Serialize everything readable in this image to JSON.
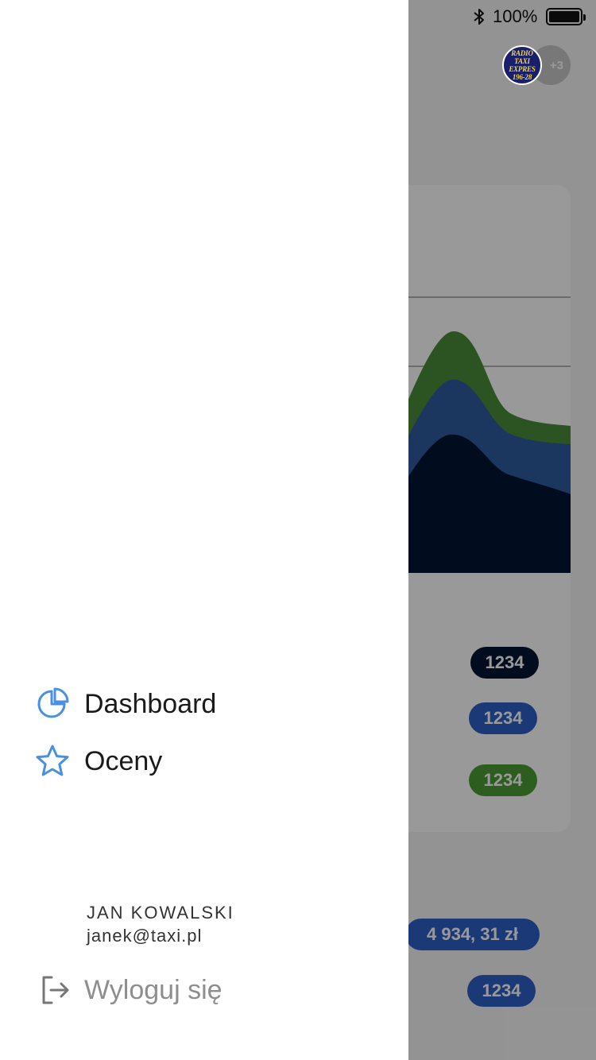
{
  "status_bar": {
    "battery_percent": "100%",
    "bluetooth_icon": "bluetooth-icon",
    "battery_icon": "battery-icon"
  },
  "header": {
    "company_logo": {
      "lines": [
        "RADIO",
        "TAXI",
        "EXPRES",
        "196-28"
      ]
    },
    "more_companies": "+3"
  },
  "chart_data": {
    "type": "area",
    "stacked": true,
    "colors": {
      "series_1": "#021434",
      "series_2": "#2e5a9e",
      "series_3": "#4a8d3a"
    },
    "visible_note": "Only the right portion of a stacked area chart is visible behind the drawer; no axis labels or legend text are visible."
  },
  "legend_values": [
    {
      "value": "1234",
      "color": "#021434"
    },
    {
      "value": "1234",
      "color": "#2e5fc7"
    },
    {
      "value": "1234",
      "color": "#4e9c36"
    }
  ],
  "summary": {
    "amount": "4 934, 31 zł",
    "count": "1234"
  },
  "drawer": {
    "menu": [
      {
        "label": "Dashboard",
        "icon": "pie-chart-icon"
      },
      {
        "label": "Oceny",
        "icon": "star-icon"
      }
    ],
    "user": {
      "name": "JAN KOWALSKI",
      "email": "janek@taxi.pl"
    },
    "logout": {
      "label": "Wyloguj się",
      "icon": "logout-icon"
    },
    "accent_color": "#4a90e2"
  }
}
